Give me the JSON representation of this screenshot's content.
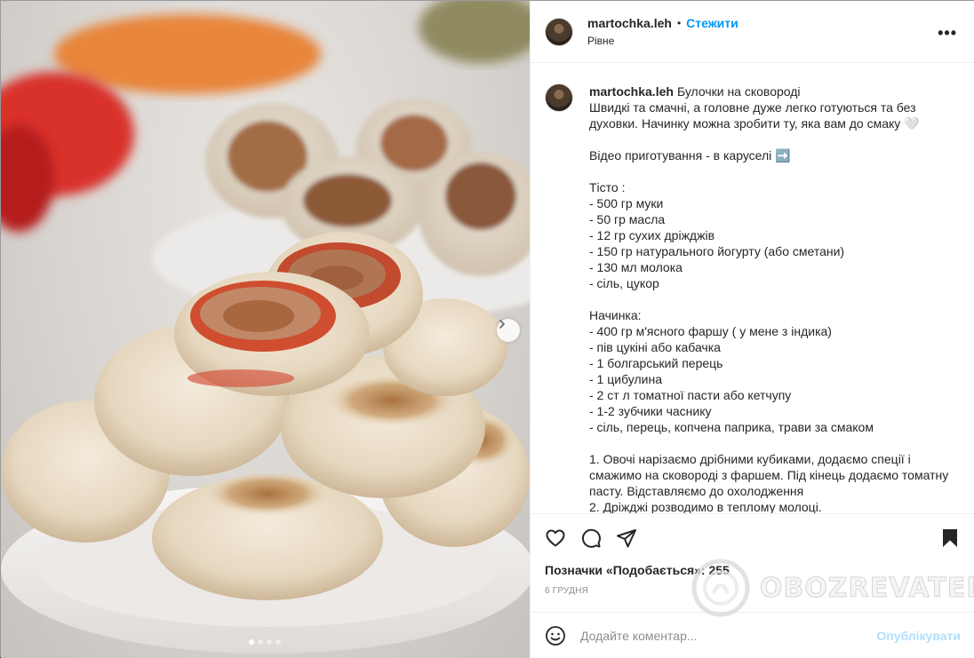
{
  "header": {
    "username": "martochka.leh",
    "separator": "•",
    "follow_label": "Стежити",
    "location": "Рівне",
    "more_label": "•••"
  },
  "caption": {
    "username": "martochka.leh",
    "text": "Булочки на сковороді\nШвидкі та смачні, а головне дуже легко готуються та без духовки. Начинку можна зробити ту, яка вам до смаку 🤍\n\nВідео приготування - в каруселі ➡️\n\nТісто :\n- 500 гр муки\n- 50 гр масла\n- 12 гр сухих дріжджів\n- 150 гр натурального йогурту (або сметани)\n- 130 мл молока\n- сіль, цукор\n\nНачинка:\n- 400 гр м'ясного фаршу ( у мене з індика)\n- пів цукіні або кабачка\n- 1 болгарський перець\n- 1 цибулина\n- 2 ст л томатної пасти або кетчупу\n- 1-2 зубчики часнику\n- сіль, перець, копчена паприка, трави за смаком\n\n1. Овочі нарізаємо дрібними кубиками, додаємо спеції і смажимо на сковороді з фаршем. Під кінець додаємо томатну пасту. Відставляємо до охолодження\n2. Дріжджі розводимо в теплому молоці."
  },
  "actions": {
    "likes_text": "Позначки «Подобається»: 255",
    "date": "6 грудня"
  },
  "comment": {
    "placeholder": "Додайте коментар...",
    "publish_label": "Опублікувати"
  },
  "watermark": {
    "text": "OBOZREVATEL"
  },
  "carousel": {
    "total_slides": 4,
    "active_slide": 1
  },
  "colors": {
    "link_blue": "#0095f6",
    "publish_disabled": "#b2dffc",
    "secondary_text": "#8e8e8e",
    "border": "#efefef"
  }
}
